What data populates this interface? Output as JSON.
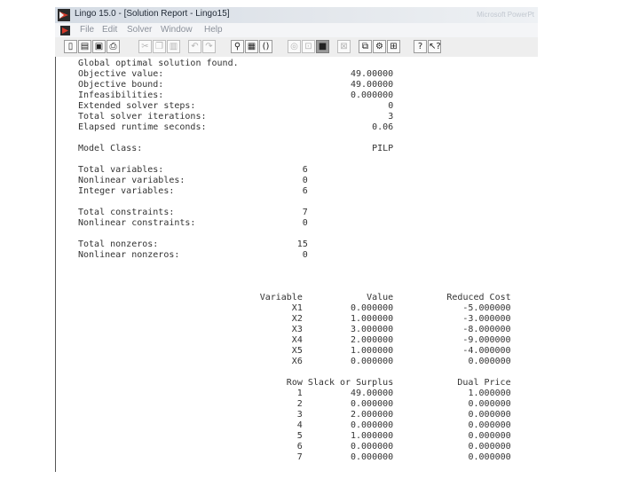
{
  "window": {
    "title": "Lingo 15.0 - [Solution Report - Lingo15]",
    "title_right": "Microsoft PowerPt"
  },
  "menu": [
    "File",
    "Edit",
    "Solver",
    "Window",
    "Help"
  ],
  "toolbar": {
    "buttons": [
      {
        "name": "new-file-icon",
        "glyph": "▯"
      },
      {
        "name": "open-file-icon",
        "glyph": "▤"
      },
      {
        "name": "save-icon",
        "glyph": "▣"
      },
      {
        "name": "print-icon",
        "glyph": "⎙"
      },
      {
        "name": "cut-icon",
        "glyph": "✂"
      },
      {
        "name": "copy-icon",
        "glyph": "❐"
      },
      {
        "name": "paste-icon",
        "glyph": "▥"
      },
      {
        "name": "undo-icon",
        "glyph": "↶"
      },
      {
        "name": "redo-icon",
        "glyph": "↷"
      },
      {
        "name": "find-icon",
        "glyph": "⚲"
      },
      {
        "name": "goto-line-icon",
        "glyph": "▦"
      },
      {
        "name": "match-paren-icon",
        "glyph": "()"
      },
      {
        "name": "solve-icon",
        "glyph": "◎"
      },
      {
        "name": "solution-icon",
        "glyph": "⊡"
      },
      {
        "name": "stop-icon",
        "glyph": "■"
      },
      {
        "name": "close-all-icon",
        "glyph": "⊠"
      },
      {
        "name": "send-to-back-icon",
        "glyph": "⧉"
      },
      {
        "name": "options-icon",
        "glyph": "⚙"
      },
      {
        "name": "tile-windows-icon",
        "glyph": "⊞"
      },
      {
        "name": "help-icon",
        "glyph": "?"
      },
      {
        "name": "context-help-icon",
        "glyph": "↖?"
      }
    ]
  },
  "report": {
    "summary": [
      {
        "label": "Global optimal solution found.",
        "value": ""
      },
      {
        "label": "Objective value:",
        "value": "49.00000"
      },
      {
        "label": "Objective bound:",
        "value": "49.00000"
      },
      {
        "label": "Infeasibilities:",
        "value": "0.000000"
      },
      {
        "label": "Extended solver steps:",
        "value": "0"
      },
      {
        "label": "Total solver iterations:",
        "value": "3"
      },
      {
        "label": "Elapsed runtime seconds:",
        "value": "0.06"
      }
    ],
    "model_class": {
      "label": "Model Class:",
      "value": "PILP"
    },
    "counts": [
      {
        "label": "Total variables:",
        "value": "6"
      },
      {
        "label": "Nonlinear variables:",
        "value": "0"
      },
      {
        "label": "Integer variables:",
        "value": "6"
      },
      {
        "label": "",
        "value": ""
      },
      {
        "label": "Total constraints:",
        "value": "7"
      },
      {
        "label": "Nonlinear constraints:",
        "value": "0"
      },
      {
        "label": "",
        "value": ""
      },
      {
        "label": "Total nonzeros:",
        "value": "15"
      },
      {
        "label": "Nonlinear nonzeros:",
        "value": "0"
      }
    ],
    "variables": {
      "headers": [
        "Variable",
        "Value",
        "Reduced Cost"
      ],
      "rows": [
        [
          "X1",
          "0.000000",
          "-5.000000"
        ],
        [
          "X2",
          "1.000000",
          "-3.000000"
        ],
        [
          "X3",
          "3.000000",
          "-8.000000"
        ],
        [
          "X4",
          "2.000000",
          "-9.000000"
        ],
        [
          "X5",
          "1.000000",
          "-4.000000"
        ],
        [
          "X6",
          "0.000000",
          "0.000000"
        ]
      ]
    },
    "rows": {
      "headers": [
        "Row",
        "Slack or Surplus",
        "Dual Price"
      ],
      "rows": [
        [
          "1",
          "49.00000",
          "1.000000"
        ],
        [
          "2",
          "0.000000",
          "0.000000"
        ],
        [
          "3",
          "2.000000",
          "0.000000"
        ],
        [
          "4",
          "0.000000",
          "0.000000"
        ],
        [
          "5",
          "1.000000",
          "0.000000"
        ],
        [
          "6",
          "0.000000",
          "0.000000"
        ],
        [
          "7",
          "0.000000",
          "0.000000"
        ]
      ]
    }
  }
}
